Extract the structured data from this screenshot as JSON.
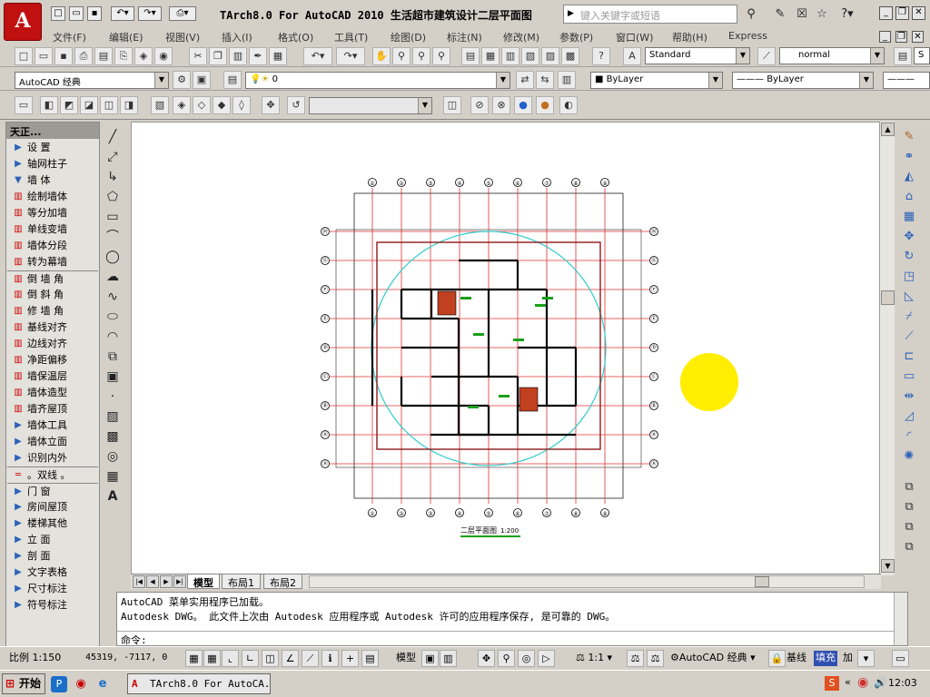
{
  "app": {
    "logo_letter": "A",
    "window_title": "TArch8.0 For AutoCAD 2010   生活超市建筑设计二层平面图",
    "search_placeholder": "键入关键字或短语"
  },
  "menu": [
    "文件(F)",
    "编辑(E)",
    "视图(V)",
    "插入(I)",
    "格式(O)",
    "工具(T)",
    "绘图(D)",
    "标注(N)",
    "修改(M)",
    "参数(P)",
    "窗口(W)",
    "帮助(H)",
    "Express"
  ],
  "toolbar": {
    "text_style": "Standard",
    "dim_style": "normal",
    "workspace": "AutoCAD 经典",
    "layer_value": "0",
    "color_value": "ByLayer",
    "linetype_value": "ByLayer"
  },
  "tpanel": {
    "title": "天正...",
    "items": [
      {
        "label": "设    置",
        "kind": "arrow"
      },
      {
        "label": "轴网柱子",
        "kind": "arrow"
      },
      {
        "label": "墙    体",
        "kind": "open"
      },
      {
        "label": "绘制墙体",
        "kind": "tool"
      },
      {
        "label": "等分加墙",
        "kind": "tool"
      },
      {
        "label": "单线变墙",
        "kind": "tool"
      },
      {
        "label": "墙体分段",
        "kind": "tool"
      },
      {
        "label": "转为幕墙",
        "kind": "tool"
      },
      {
        "label": "倒 墙 角",
        "kind": "tool"
      },
      {
        "label": "倒 斜 角",
        "kind": "tool"
      },
      {
        "label": "修 墙 角",
        "kind": "tool"
      },
      {
        "label": "基线对齐",
        "kind": "tool"
      },
      {
        "label": "边线对齐",
        "kind": "tool"
      },
      {
        "label": "净距偏移",
        "kind": "tool"
      },
      {
        "label": "墙保温层",
        "kind": "tool"
      },
      {
        "label": "墙体造型",
        "kind": "tool"
      },
      {
        "label": "墙齐屋顶",
        "kind": "tool"
      },
      {
        "label": "墙体工具",
        "kind": "arrow"
      },
      {
        "label": "墙体立面",
        "kind": "arrow"
      },
      {
        "label": "识别内外",
        "kind": "arrow"
      },
      {
        "label": "。双线 。",
        "kind": "line"
      },
      {
        "label": "门    窗",
        "kind": "arrow"
      },
      {
        "label": "房间屋顶",
        "kind": "arrow"
      },
      {
        "label": "楼梯其他",
        "kind": "arrow"
      },
      {
        "label": "立    面",
        "kind": "arrow"
      },
      {
        "label": "剖    面",
        "kind": "arrow"
      },
      {
        "label": "文字表格",
        "kind": "arrow"
      },
      {
        "label": "尺寸标注",
        "kind": "arrow"
      },
      {
        "label": "符号标注",
        "kind": "arrow"
      }
    ]
  },
  "drawing": {
    "caption": "二层平面图",
    "scale_text": "1:200",
    "axis_top": [
      "①",
      "②",
      "③",
      "④",
      "⑤",
      "⑥",
      "⑦",
      "⑧",
      "⑨"
    ],
    "axis_side": [
      "Ⓗ",
      "Ⓖ",
      "Ⓕ",
      "Ⓔ",
      "Ⓓ",
      "Ⓒ",
      "Ⓑ",
      "Ⓐ",
      "Ⓐ"
    ]
  },
  "tabs": [
    "模型",
    "布局1",
    "布局2"
  ],
  "command": {
    "line1": "AutoCAD 菜单实用程序已加载。",
    "line2": "Autodesk DWG。  此文件上次由 Autodesk 应用程序或 Autodesk 许可的应用程序保存, 是可靠的 DWG。",
    "prompt": "命令:"
  },
  "status": {
    "scale": "比例 1:150",
    "coords": "45319, -7117, 0",
    "model": "模型",
    "anno_scale": "1:1",
    "workspace": "AutoCAD 经典",
    "baseline": "基线",
    "fill": "填充",
    "add": "加"
  },
  "taskbar": {
    "start": "开始",
    "task": "TArch8.0 For AutoCA...",
    "clock": "12:03"
  },
  "colors": {
    "accent": "#c01010",
    "grid": "#e03030",
    "wall": "#000000",
    "circle": "#33cccc",
    "highlight": "#ffee00"
  }
}
